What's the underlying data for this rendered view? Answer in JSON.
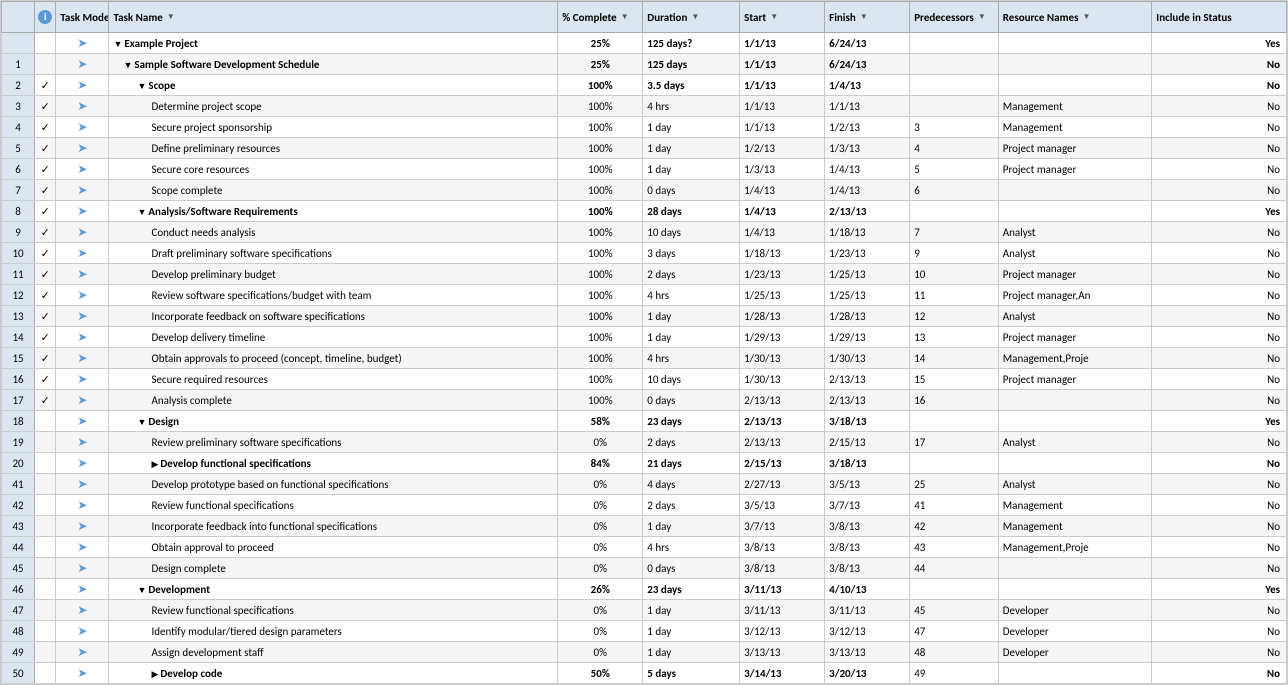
{
  "headers": {
    "row_num": "",
    "info": "i",
    "task_mode": "Task Mode",
    "task_name": "Task Name",
    "pct_complete": "% Complete",
    "duration": "Duration",
    "start": "Start",
    "finish": "Finish",
    "predecessors": "Predecessors",
    "resource_names": "Resource Names",
    "include_in_status": "Include in Status"
  },
  "rows": [
    {
      "id": "",
      "check": "",
      "mode": "arrow",
      "indent": 1,
      "name": "Example Project",
      "bold": true,
      "collapse": true,
      "pct": "25%",
      "duration": "125 days?",
      "start": "1/1/13",
      "finish": "6/24/13",
      "pred": "",
      "res": "",
      "status": "Yes"
    },
    {
      "id": "1",
      "check": "",
      "mode": "arrow",
      "indent": 2,
      "name": "Sample Software Development Schedule",
      "bold": true,
      "collapse": true,
      "pct": "25%",
      "duration": "125 days",
      "start": "1/1/13",
      "finish": "6/24/13",
      "pred": "",
      "res": "",
      "status": "No"
    },
    {
      "id": "2",
      "check": "✓",
      "mode": "arrow",
      "indent": 3,
      "name": "Scope",
      "bold": true,
      "collapse": true,
      "pct": "100%",
      "duration": "3.5 days",
      "start": "1/1/13",
      "finish": "1/4/13",
      "pred": "",
      "res": "",
      "status": "No"
    },
    {
      "id": "3",
      "check": "✓",
      "mode": "arrow",
      "indent": 4,
      "name": "Determine project scope",
      "bold": false,
      "collapse": false,
      "pct": "100%",
      "duration": "4 hrs",
      "start": "1/1/13",
      "finish": "1/1/13",
      "pred": "",
      "res": "Management",
      "status": "No"
    },
    {
      "id": "4",
      "check": "✓",
      "mode": "arrow",
      "indent": 4,
      "name": "Secure project sponsorship",
      "bold": false,
      "collapse": false,
      "pct": "100%",
      "duration": "1 day",
      "start": "1/1/13",
      "finish": "1/2/13",
      "pred": "3",
      "res": "Management",
      "status": "No"
    },
    {
      "id": "5",
      "check": "✓",
      "mode": "arrow",
      "indent": 4,
      "name": "Define preliminary resources",
      "bold": false,
      "collapse": false,
      "pct": "100%",
      "duration": "1 day",
      "start": "1/2/13",
      "finish": "1/3/13",
      "pred": "4",
      "res": "Project manager",
      "status": "No"
    },
    {
      "id": "6",
      "check": "✓",
      "mode": "arrow",
      "indent": 4,
      "name": "Secure core resources",
      "bold": false,
      "collapse": false,
      "pct": "100%",
      "duration": "1 day",
      "start": "1/3/13",
      "finish": "1/4/13",
      "pred": "5",
      "res": "Project manager",
      "status": "No"
    },
    {
      "id": "7",
      "check": "✓",
      "mode": "arrow",
      "indent": 4,
      "name": "Scope complete",
      "bold": false,
      "collapse": false,
      "pct": "100%",
      "duration": "0 days",
      "start": "1/4/13",
      "finish": "1/4/13",
      "pred": "6",
      "res": "",
      "status": "No"
    },
    {
      "id": "8",
      "check": "✓",
      "mode": "arrow",
      "indent": 3,
      "name": "Analysis/Software Requirements",
      "bold": true,
      "collapse": true,
      "pct": "100%",
      "duration": "28 days",
      "start": "1/4/13",
      "finish": "2/13/13",
      "pred": "",
      "res": "",
      "status": "Yes"
    },
    {
      "id": "9",
      "check": "✓",
      "mode": "arrow",
      "indent": 4,
      "name": "Conduct needs analysis",
      "bold": false,
      "collapse": false,
      "pct": "100%",
      "duration": "10 days",
      "start": "1/4/13",
      "finish": "1/18/13",
      "pred": "7",
      "res": "Analyst",
      "status": "No"
    },
    {
      "id": "10",
      "check": "✓",
      "mode": "arrow",
      "indent": 4,
      "name": "Draft preliminary software specifications",
      "bold": false,
      "collapse": false,
      "pct": "100%",
      "duration": "3 days",
      "start": "1/18/13",
      "finish": "1/23/13",
      "pred": "9",
      "res": "Analyst",
      "status": "No"
    },
    {
      "id": "11",
      "check": "✓",
      "mode": "arrow",
      "indent": 4,
      "name": "Develop preliminary budget",
      "bold": false,
      "collapse": false,
      "pct": "100%",
      "duration": "2 days",
      "start": "1/23/13",
      "finish": "1/25/13",
      "pred": "10",
      "res": "Project manager",
      "status": "No"
    },
    {
      "id": "12",
      "check": "✓",
      "mode": "arrow",
      "indent": 4,
      "name": "Review software specifications/budget with team",
      "bold": false,
      "collapse": false,
      "pct": "100%",
      "duration": "4 hrs",
      "start": "1/25/13",
      "finish": "1/25/13",
      "pred": "11",
      "res": "Project manager,An",
      "status": "No"
    },
    {
      "id": "13",
      "check": "✓",
      "mode": "arrow",
      "indent": 4,
      "name": "Incorporate feedback on software specifications",
      "bold": false,
      "collapse": false,
      "pct": "100%",
      "duration": "1 day",
      "start": "1/28/13",
      "finish": "1/28/13",
      "pred": "12",
      "res": "Analyst",
      "status": "No"
    },
    {
      "id": "14",
      "check": "✓",
      "mode": "arrow",
      "indent": 4,
      "name": "Develop delivery timeline",
      "bold": false,
      "collapse": false,
      "pct": "100%",
      "duration": "1 day",
      "start": "1/29/13",
      "finish": "1/29/13",
      "pred": "13",
      "res": "Project manager",
      "status": "No"
    },
    {
      "id": "15",
      "check": "✓",
      "mode": "arrow",
      "indent": 4,
      "name": "Obtain approvals to proceed (concept, timeline, budget)",
      "bold": false,
      "collapse": false,
      "pct": "100%",
      "duration": "4 hrs",
      "start": "1/30/13",
      "finish": "1/30/13",
      "pred": "14",
      "res": "Management,Proje",
      "status": "No"
    },
    {
      "id": "16",
      "check": "✓",
      "mode": "arrow",
      "indent": 4,
      "name": "Secure required resources",
      "bold": false,
      "collapse": false,
      "pct": "100%",
      "duration": "10 days",
      "start": "1/30/13",
      "finish": "2/13/13",
      "pred": "15",
      "res": "Project manager",
      "status": "No"
    },
    {
      "id": "17",
      "check": "✓",
      "mode": "arrow",
      "indent": 4,
      "name": "Analysis complete",
      "bold": false,
      "collapse": false,
      "pct": "100%",
      "duration": "0 days",
      "start": "2/13/13",
      "finish": "2/13/13",
      "pred": "16",
      "res": "",
      "status": "No"
    },
    {
      "id": "18",
      "check": "",
      "mode": "arrow",
      "indent": 3,
      "name": "Design",
      "bold": true,
      "collapse": true,
      "pct": "58%",
      "duration": "23 days",
      "start": "2/13/13",
      "finish": "3/18/13",
      "pred": "",
      "res": "",
      "status": "Yes"
    },
    {
      "id": "19",
      "check": "",
      "mode": "arrow",
      "indent": 4,
      "name": "Review preliminary software specifications",
      "bold": false,
      "collapse": false,
      "pct": "0%",
      "duration": "2 days",
      "start": "2/13/13",
      "finish": "2/15/13",
      "pred": "17",
      "res": "Analyst",
      "status": "No"
    },
    {
      "id": "20",
      "check": "",
      "mode": "arrow",
      "indent": 4,
      "name": "Develop functional specifications",
      "bold": true,
      "collapse": false,
      "expand": true,
      "pct": "84%",
      "duration": "21 days",
      "start": "2/15/13",
      "finish": "3/18/13",
      "pred": "",
      "res": "",
      "status": "No"
    },
    {
      "id": "41",
      "check": "",
      "mode": "arrow",
      "indent": 4,
      "name": "Develop prototype based on functional specifications",
      "bold": false,
      "collapse": false,
      "pct": "0%",
      "duration": "4 days",
      "start": "2/27/13",
      "finish": "3/5/13",
      "pred": "25",
      "res": "Analyst",
      "status": "No"
    },
    {
      "id": "42",
      "check": "",
      "mode": "arrow",
      "indent": 4,
      "name": "Review functional specifications",
      "bold": false,
      "collapse": false,
      "pct": "0%",
      "duration": "2 days",
      "start": "3/5/13",
      "finish": "3/7/13",
      "pred": "41",
      "res": "Management",
      "status": "No"
    },
    {
      "id": "43",
      "check": "",
      "mode": "arrow",
      "indent": 4,
      "name": "Incorporate feedback into functional specifications",
      "bold": false,
      "collapse": false,
      "pct": "0%",
      "duration": "1 day",
      "start": "3/7/13",
      "finish": "3/8/13",
      "pred": "42",
      "res": "Management",
      "status": "No"
    },
    {
      "id": "44",
      "check": "",
      "mode": "arrow",
      "indent": 4,
      "name": "Obtain approval to proceed",
      "bold": false,
      "collapse": false,
      "pct": "0%",
      "duration": "4 hrs",
      "start": "3/8/13",
      "finish": "3/8/13",
      "pred": "43",
      "res": "Management,Proje",
      "status": "No"
    },
    {
      "id": "45",
      "check": "",
      "mode": "arrow",
      "indent": 4,
      "name": "Design complete",
      "bold": false,
      "collapse": false,
      "pct": "0%",
      "duration": "0 days",
      "start": "3/8/13",
      "finish": "3/8/13",
      "pred": "44",
      "res": "",
      "status": "No"
    },
    {
      "id": "46",
      "check": "",
      "mode": "arrow",
      "indent": 3,
      "name": "Development",
      "bold": true,
      "collapse": true,
      "pct": "26%",
      "duration": "23 days",
      "start": "3/11/13",
      "finish": "4/10/13",
      "pred": "",
      "res": "",
      "status": "Yes"
    },
    {
      "id": "47",
      "check": "",
      "mode": "arrow",
      "indent": 4,
      "name": "Review functional specifications",
      "bold": false,
      "collapse": false,
      "pct": "0%",
      "duration": "1 day",
      "start": "3/11/13",
      "finish": "3/11/13",
      "pred": "45",
      "res": "Developer",
      "status": "No"
    },
    {
      "id": "48",
      "check": "",
      "mode": "arrow",
      "indent": 4,
      "name": "Identify modular/tiered design parameters",
      "bold": false,
      "collapse": false,
      "pct": "0%",
      "duration": "1 day",
      "start": "3/12/13",
      "finish": "3/12/13",
      "pred": "47",
      "res": "Developer",
      "status": "No"
    },
    {
      "id": "49",
      "check": "",
      "mode": "arrow",
      "indent": 4,
      "name": "Assign development staff",
      "bold": false,
      "collapse": false,
      "pct": "0%",
      "duration": "1 day",
      "start": "3/13/13",
      "finish": "3/13/13",
      "pred": "48",
      "res": "Developer",
      "status": "No"
    },
    {
      "id": "50",
      "check": "",
      "mode": "arrow",
      "indent": 4,
      "name": "Develop code",
      "bold": true,
      "collapse": false,
      "expand": true,
      "pct": "50%",
      "duration": "5 days",
      "start": "3/14/13",
      "finish": "3/20/13",
      "pred": "49",
      "res": "",
      "status": "No"
    }
  ]
}
